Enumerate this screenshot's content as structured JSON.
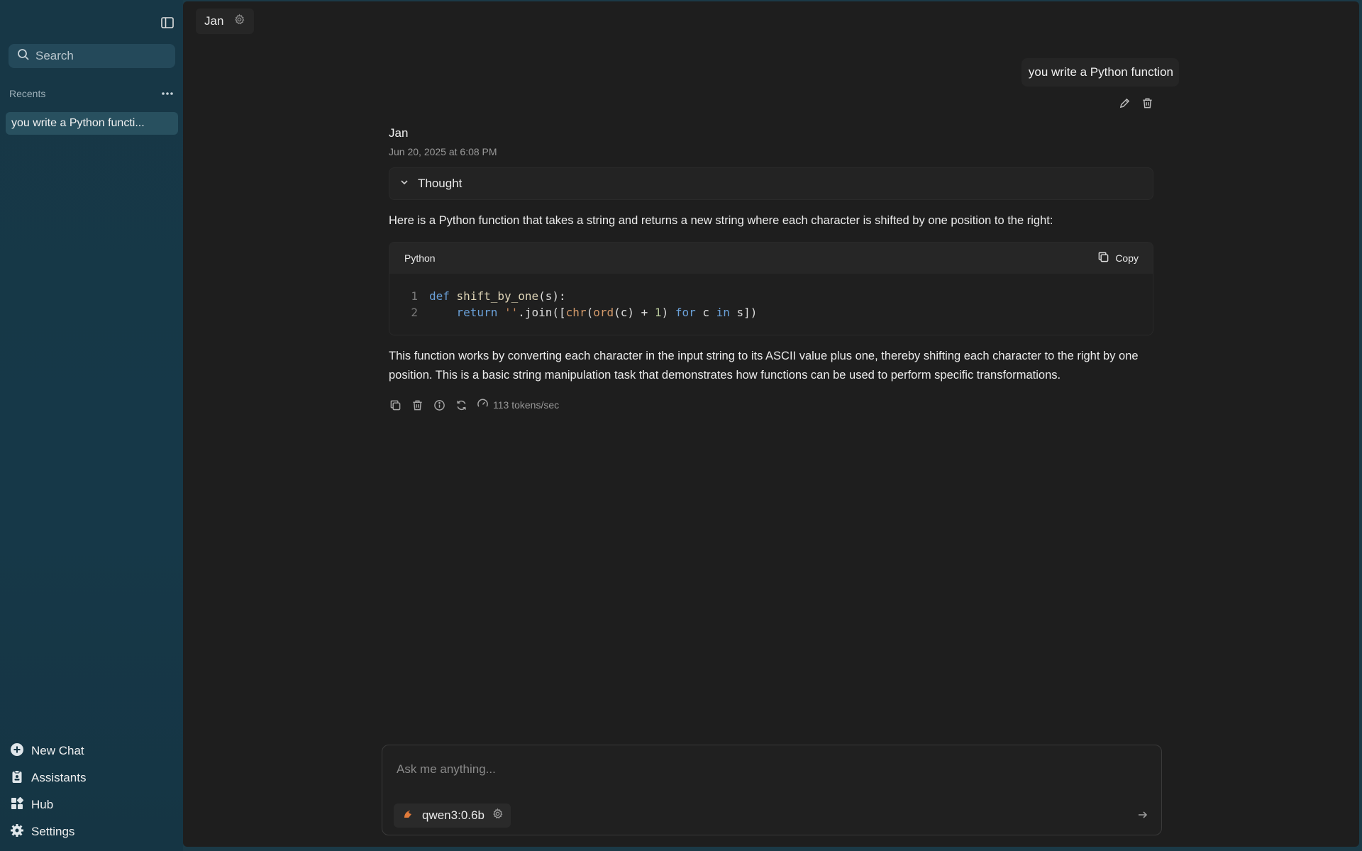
{
  "sidebar": {
    "search_placeholder": "Search",
    "recents_label": "Recents",
    "recent_items": [
      {
        "label": "you write a Python functi..."
      }
    ],
    "nav": [
      {
        "label": "New Chat",
        "icon": "plus-circle-icon"
      },
      {
        "label": "Assistants",
        "icon": "clipboard-icon"
      },
      {
        "label": "Hub",
        "icon": "grid-icon"
      },
      {
        "label": "Settings",
        "icon": "gear-icon"
      }
    ]
  },
  "tab": {
    "title": "Jan"
  },
  "chat": {
    "user_message": "you write a Python function",
    "assistant_name": "Jan",
    "assistant_date": "Jun 20, 2025 at 6:08 PM",
    "thought_label": "Thought",
    "intro": "Here is a Python function that takes a string and returns a new string where each character is shifted by one position to the right:",
    "code": {
      "language": "Python",
      "copy_label": "Copy",
      "line_numbers": [
        "1",
        "2"
      ]
    },
    "outro": "This function works by converting each character in the input string to its ASCII value plus one, thereby shifting each character to the right by one position. This is a basic string manipulation task that demonstrates how functions can be used to perform specific transformations.",
    "tokens_label": "113 tokens/sec"
  },
  "composer": {
    "placeholder": "Ask me anything...",
    "model": "qwen3:0.6b"
  },
  "colors": {
    "sidebar_bg": "#173746",
    "main_bg": "#1e1e1e",
    "keyword": "#6aa0d8"
  }
}
